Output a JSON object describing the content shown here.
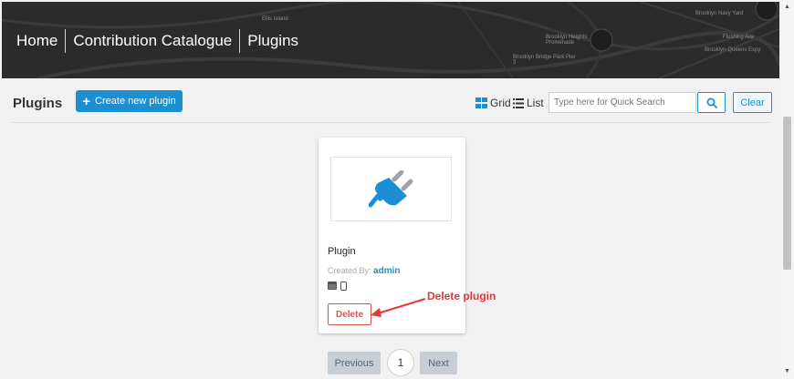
{
  "breadcrumb": {
    "items": [
      "Home",
      "Contribution Catalogue",
      "Plugins"
    ]
  },
  "banner_map_labels": [
    "Brooklyn Navy Yard",
    "Flushing Ave",
    "Brooklyn-Queens Expy",
    "Ellis Island",
    "Brooklyn Heights Promenade",
    "Brooklyn Bridge Park Pier 3"
  ],
  "toolbar": {
    "title": "Plugins",
    "create_label": "Create new plugin",
    "grid_label": "Grid",
    "list_label": "List",
    "search_placeholder": "Type here for Quick Search",
    "clear_label": "Clear"
  },
  "card": {
    "title": "Plugin",
    "created_by_label": "Created By:",
    "author": "admin",
    "delete_label": "Delete",
    "icons": [
      "plug-icon",
      "desktop-icon",
      "mobile-icon"
    ]
  },
  "annotation": {
    "text": "Delete plugin",
    "color": "#e0393e"
  },
  "pagination": {
    "previous": "Previous",
    "current": "1",
    "next": "Next"
  },
  "colors": {
    "accent": "#1b8fd2",
    "danger": "#d9534f",
    "banner": "#2b2b2b"
  }
}
